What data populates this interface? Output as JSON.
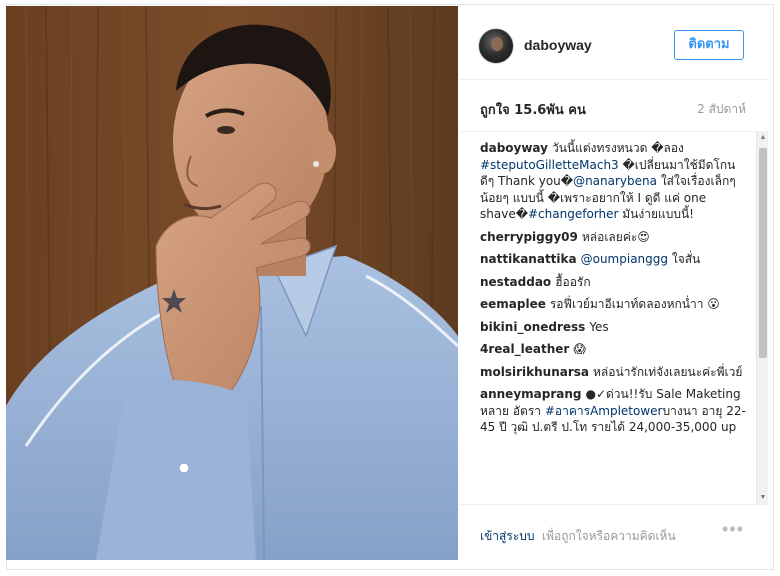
{
  "post": {
    "username": "daboyway",
    "follow_label": "ติดตาม",
    "likes": "ถูกใจ 15.6พัน คน",
    "time_ago": "2 สัปดาห์",
    "comments": [
      {
        "user": "daboyway",
        "parts": [
          {
            "t": "วันนี้แต่งทรงหนวด �ลอง "
          },
          {
            "t": "#steputoGilletteMach3",
            "k": "tag"
          },
          {
            "t": " �เปลี่ยนมาใช้มีดโกนดีๆ Thank you�"
          },
          {
            "t": "@nanarybena",
            "k": "mention"
          },
          {
            "t": " ใส่ใจเรื่องเล็กๆน้อยๆ แบบนี้ �เพราะอยากให้ I ดูดี แค่ one shave�"
          },
          {
            "t": "#changeforher",
            "k": "tag"
          },
          {
            "t": " มันง่ายแบบนี้!"
          }
        ]
      },
      {
        "user": "cherrypiggy09",
        "parts": [
          {
            "t": "หล่อเลยค่ะ😍"
          }
        ]
      },
      {
        "user": "nattikanattika",
        "parts": [
          {
            "t": "@oumpianggg",
            "k": "mention"
          },
          {
            "t": " ใจสั่น"
          }
        ]
      },
      {
        "user": "nestaddao",
        "parts": [
          {
            "t": "ฮื้ออรัก"
          }
        ]
      },
      {
        "user": "eemaplee",
        "parts": [
          {
            "t": "รอฟี่เวย์มาอีเมาท์ดลองหกน่ำา 😮"
          }
        ]
      },
      {
        "user": "bikini_onedress",
        "parts": [
          {
            "t": "Yes"
          }
        ]
      },
      {
        "user": "4real_leather",
        "parts": [
          {
            "t": "😱"
          }
        ]
      },
      {
        "user": "molsirikhunarsa",
        "parts": [
          {
            "t": "หล่อน่ารักเท่จังเลยนะค่ะพี่เวย์"
          }
        ]
      },
      {
        "user": "anneymaprang",
        "parts": [
          {
            "t": "●✓ด่วน!!รับ Sale Maketing หลาย อัตรา "
          },
          {
            "t": "#อาคารAmpletower",
            "k": "tag"
          },
          {
            "t": "บางนา อายุ 22-45 ปี วุฒิ ป.ตรี ป.โท รายได้ 24,000-35,000 up"
          }
        ]
      }
    ],
    "footer": {
      "login_label": "เข้าสู่ระบบ",
      "login_prompt": "เพื่อถูกใจหรือความคิดเห็น",
      "more_label": "•••"
    }
  },
  "colors": {
    "link": "#003569",
    "follow_button": "#3897f0",
    "muted_text": "#999999",
    "photo_background": "#6b4424",
    "shirt": "#9ab3d6"
  },
  "icons": [
    "scroll-up-arrow-icon",
    "scroll-down-arrow-icon",
    "more-options-icon",
    "star-tattoo-icon"
  ]
}
